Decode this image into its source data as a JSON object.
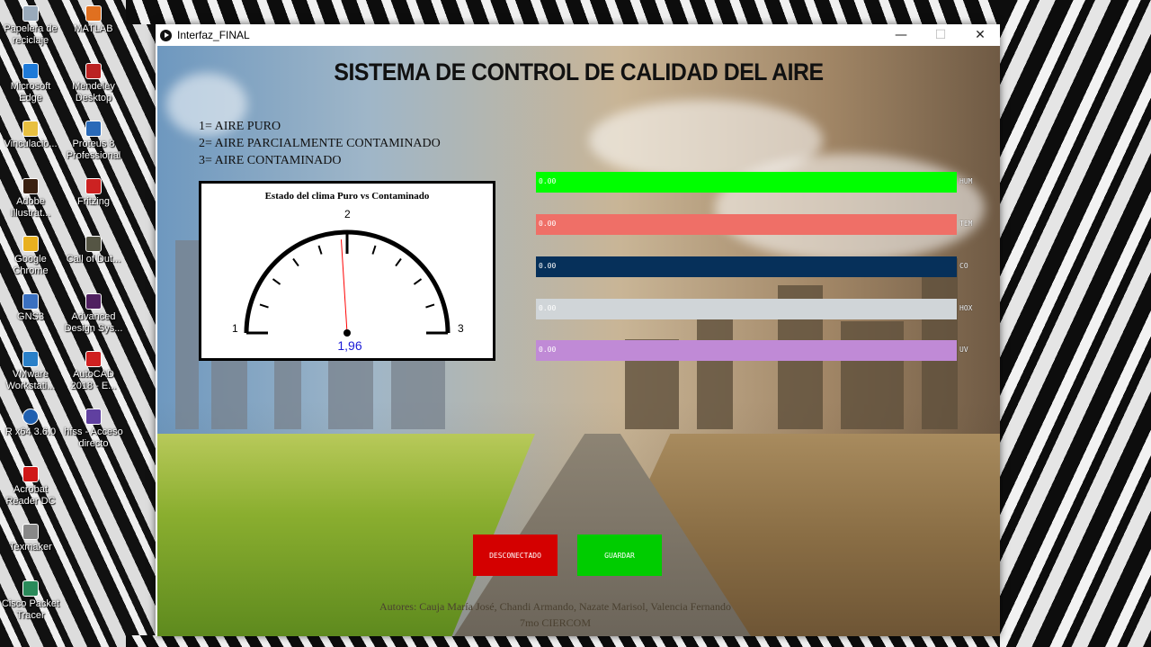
{
  "desktop": {
    "icons": [
      {
        "label": "Papelera de\nreciclaje"
      },
      {
        "label": "MATLAB"
      },
      {
        "label": "Microsoft\nEdge"
      },
      {
        "label": "Mendeley\nDesktop"
      },
      {
        "label": "Vinculacio..."
      },
      {
        "label": "Proteus 8\nProfessional"
      },
      {
        "label": "Adobe\nIllustrat..."
      },
      {
        "label": "Fritzing"
      },
      {
        "label": "Google\nChrome"
      },
      {
        "label": "Call of Dut..."
      },
      {
        "label": "GNS3"
      },
      {
        "label": "Advanced\nDesign Sys..."
      },
      {
        "label": "VMware\nWorkstati..."
      },
      {
        "label": "AutoCAD\n2018 - E..."
      },
      {
        "label": "R x64 3.6.0"
      },
      {
        "label": "hfss - Acceso\ndirecto"
      },
      {
        "label": "Acrobat\nReader DC"
      },
      {
        "label": "Texmaker"
      },
      {
        "label": "Cisco Packet\nTracer"
      }
    ]
  },
  "window": {
    "title": "Interfaz_FINAL",
    "controls": {
      "minimize": "—",
      "maximize": "☐",
      "close": "✕"
    }
  },
  "app": {
    "title": "SISTEMA DE CONTROL DE CALIDAD DEL AIRE",
    "legend": [
      "1= AIRE PURO",
      "2= AIRE PARCIALMENTE CONTAMINADO",
      "3= AIRE CONTAMINADO"
    ],
    "gauge": {
      "title": "Estado del clima Puro vs Contaminado",
      "min_label": "1",
      "mid_label": "2",
      "max_label": "3",
      "min": 1,
      "max": 3,
      "value": 1.96,
      "value_text": "1,96",
      "needle_color": "#ff0000",
      "value_color": "#1a1ad6"
    },
    "bars": [
      {
        "label": "HUM",
        "value": "0.00",
        "color": "#00ff00"
      },
      {
        "label": "TEM",
        "value": "0.00",
        "color": "#ef6f67"
      },
      {
        "label": "CO",
        "value": "0.00",
        "color": "#06305a"
      },
      {
        "label": "HOX",
        "value": "0.00",
        "color": "#d0d5d8"
      },
      {
        "label": "UV",
        "value": "0.00",
        "color": "#c08ad6"
      }
    ],
    "buttons": {
      "disconnect": {
        "label": "DESCONECTADO",
        "color": "#d40000"
      },
      "save": {
        "label": "GUARDAR",
        "color": "#00cc00"
      }
    },
    "footer": {
      "authors": "Autores: Cauja María José, Chandi Armando, Nazate Marisol, Valencia Fernando",
      "course": "7mo CIERCOM"
    }
  }
}
